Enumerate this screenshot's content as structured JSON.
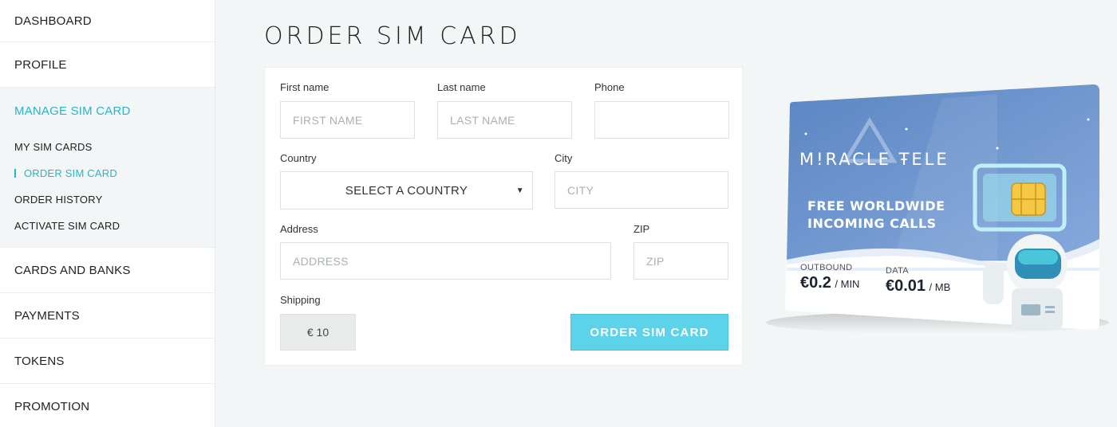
{
  "sidebar": {
    "items_top": [
      "DASHBOARD",
      "PROFILE"
    ],
    "group": {
      "title": "MANAGE SIM CARD",
      "sub_items": [
        "MY SIM CARDS",
        "ORDER SIM CARD",
        "ORDER HISTORY",
        "ACTIVATE SIM CARD"
      ],
      "active_index": 1
    },
    "items_bottom": [
      "CARDS AND BANKS",
      "PAYMENTS",
      "TOKENS",
      "PROMOTION"
    ]
  },
  "page": {
    "title": "ORDER SIM CARD"
  },
  "form": {
    "first_name": {
      "label": "First name",
      "placeholder": "FIRST NAME"
    },
    "last_name": {
      "label": "Last name",
      "placeholder": "LAST NAME"
    },
    "phone": {
      "label": "Phone",
      "placeholder": ""
    },
    "country": {
      "label": "Country",
      "selected": "SELECT A COUNTRY"
    },
    "city": {
      "label": "City",
      "placeholder": "CITY"
    },
    "address": {
      "label": "Address",
      "placeholder": "ADDRESS"
    },
    "zip": {
      "label": "ZIP",
      "placeholder": "ZIP"
    },
    "shipping": {
      "label": "Shipping",
      "value": "€ 10"
    },
    "submit_label": "ORDER SIM CARD"
  },
  "promo_card": {
    "brand": "M!RACLE ŦELE",
    "tagline_line1": "FREE WORLDWIDE",
    "tagline_line2": "INCOMING CALLS",
    "outbound_label": "OUTBOUND",
    "outbound_value": "€0.2",
    "outbound_unit": "/ MIN",
    "data_label": "DATA",
    "data_value": "€0.01",
    "data_unit": "/ MB"
  },
  "colors": {
    "accent": "#2bb3c9",
    "button": "#5cd3e8",
    "card_blue": "#6f97cf",
    "background": "#f2f6f6"
  }
}
